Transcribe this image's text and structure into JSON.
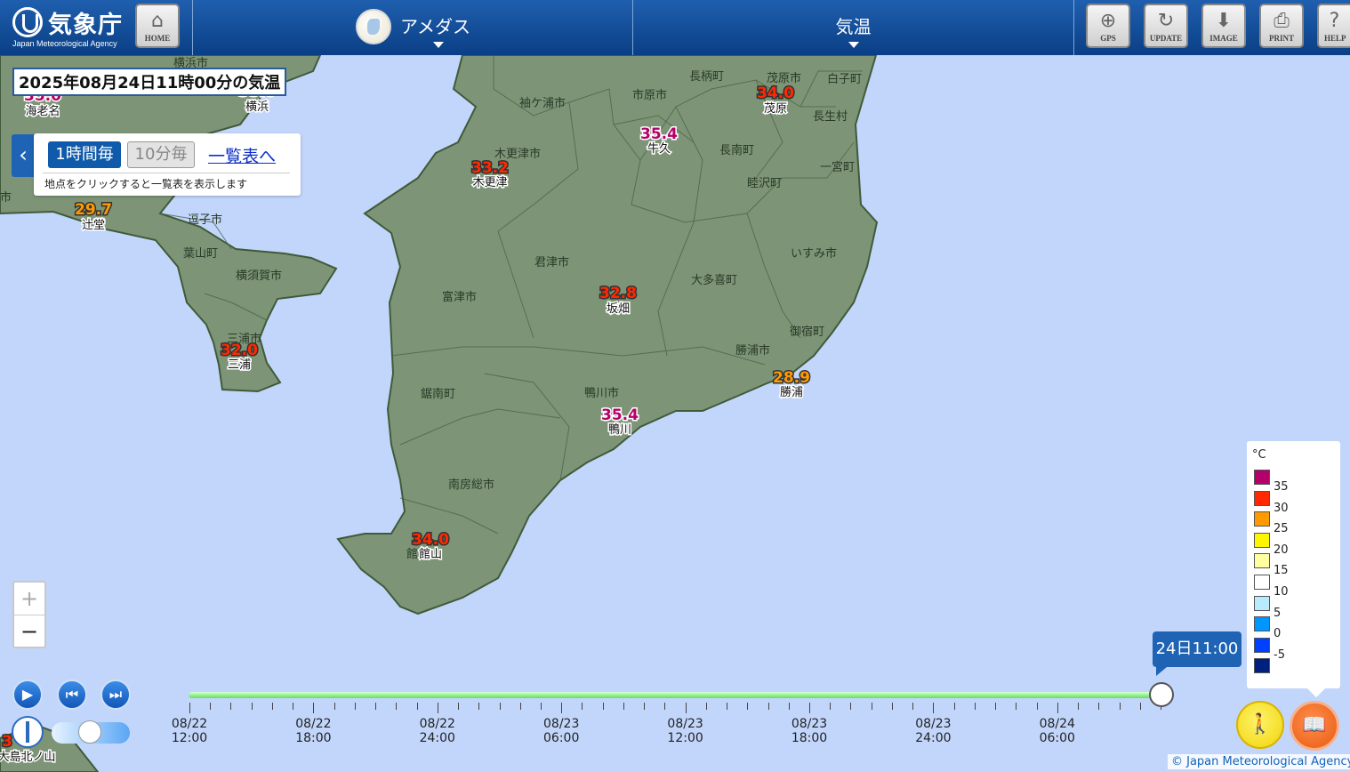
{
  "header": {
    "logo_text": "気象庁",
    "logo_sub": "Japan Meteorological Agency",
    "home_label": "HOME",
    "product_label": "アメダス",
    "element_label": "気温",
    "tools": [
      {
        "name": "gps",
        "label": "GPS",
        "icon": "crosshair-icon"
      },
      {
        "name": "update",
        "label": "UPDATE",
        "icon": "refresh-icon"
      },
      {
        "name": "image",
        "label": "IMAGE",
        "icon": "download-icon"
      },
      {
        "name": "print",
        "label": "PRINT",
        "icon": "printer-icon"
      },
      {
        "name": "help",
        "label": "HELP",
        "icon": "question-icon"
      }
    ]
  },
  "title": "2025年08月24日11時00分の気温",
  "panel": {
    "btn_1h": "1時間毎",
    "btn_10m": "10分毎",
    "list_link": "一覧表へ",
    "hint": "地点をクリックすると一覧表を表示します"
  },
  "zoom": {
    "in": "+",
    "out": "−"
  },
  "colors": {
    "land": "#7d9576",
    "sea": "#c2d6fb",
    "temp_35": "#b4006a",
    "temp_30": "#ff2800",
    "temp_25": "#ff9900"
  },
  "stations": [
    {
      "name": "海老名",
      "value": "35.0"
    },
    {
      "name": "横浜",
      "value": "35.0"
    },
    {
      "name": "辻堂",
      "value": "29.7"
    },
    {
      "name": "三浦",
      "value": "32.0"
    },
    {
      "name": "木更津",
      "value": "33.2"
    },
    {
      "name": "牛久",
      "value": "35.4"
    },
    {
      "name": "茂原",
      "value": "34.0"
    },
    {
      "name": "坂畑",
      "value": "32.8"
    },
    {
      "name": "勝浦",
      "value": "28.9"
    },
    {
      "name": "鴨川",
      "value": "35.4"
    },
    {
      "name": "館山",
      "value": "34.0"
    },
    {
      "name": "大島北ノ山",
      "value": "3"
    }
  ],
  "places": [
    "横浜市",
    "逗子市",
    "葉山町",
    "横須賀市",
    "三浦市",
    "袖ケ浦市",
    "木更津市",
    "市原市",
    "長柄町",
    "茂原市",
    "白子町",
    "長生村",
    "長南町",
    "一宮町",
    "睦沢町",
    "君津市",
    "富津市",
    "大多喜町",
    "いすみ市",
    "御宿町",
    "勝浦市",
    "鴨川市",
    "鋸南町",
    "南房総市",
    "館山市",
    "市"
  ],
  "legend": {
    "unit": "°C",
    "items": [
      {
        "color": "#b4006a",
        "label": "35"
      },
      {
        "color": "#ff2800",
        "label": "30"
      },
      {
        "color": "#ff9900",
        "label": "25"
      },
      {
        "color": "#fff500",
        "label": "20"
      },
      {
        "color": "#ffffa0",
        "label": "15"
      },
      {
        "color": "#ffffff",
        "label": "10"
      },
      {
        "color": "#b9ebff",
        "label": "5"
      },
      {
        "color": "#0096ff",
        "label": "0"
      },
      {
        "color": "#0041ff",
        "label": "-5"
      },
      {
        "color": "#002080",
        "label": ""
      }
    ]
  },
  "timeline": {
    "current": "24日11:00",
    "labels": [
      {
        "date": "08/22",
        "time": "12:00"
      },
      {
        "date": "08/22",
        "time": "18:00"
      },
      {
        "date": "08/22",
        "time": "24:00"
      },
      {
        "date": "08/23",
        "time": "06:00"
      },
      {
        "date": "08/23",
        "time": "12:00"
      },
      {
        "date": "08/23",
        "time": "18:00"
      },
      {
        "date": "08/23",
        "time": "24:00"
      },
      {
        "date": "08/24",
        "time": "06:00"
      }
    ],
    "position": 1.0
  },
  "copyright": "© Japan Meteorological Agency"
}
